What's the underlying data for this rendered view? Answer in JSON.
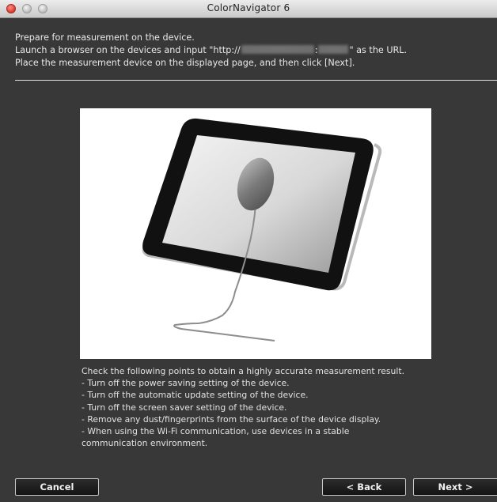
{
  "window": {
    "title": "ColorNavigator 6"
  },
  "instructions": {
    "line1": "Prepare for measurement on the device.",
    "line2_prefix": "Launch a browser on the devices and input \"http://",
    "line2_colon": ":",
    "line2_suffix": "\" as the URL.",
    "line3": "Place the measurement device on the displayed page, and then click [Next]."
  },
  "checklist": {
    "heading": "Check the following points to obtain a highly accurate measurement result.",
    "items": [
      "- Turn off the power saving setting of the device.",
      "- Turn off the automatic update setting of the device.",
      "- Turn off the screen saver setting of the device.",
      "- Remove any dust/fingerprints from the surface of the device display.",
      "- When using the Wi-Fi communication, use devices in a stable",
      "communication environment."
    ]
  },
  "buttons": {
    "cancel": "Cancel",
    "back": "< Back",
    "next": "Next >"
  },
  "icons": {
    "illustration": "tablet-with-measurement-sensor-illustration"
  }
}
